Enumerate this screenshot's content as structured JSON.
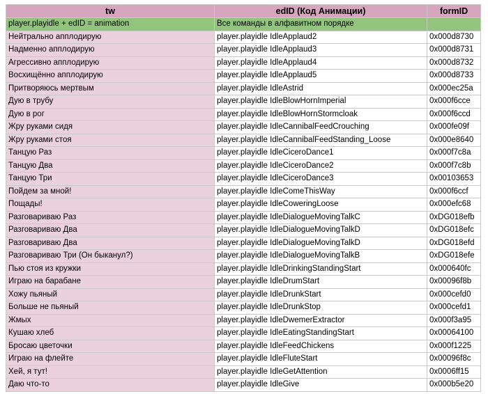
{
  "colors": {
    "header_bg": "#d5a6bd",
    "tw_column_bg": "#ead1dc",
    "subheader_bg": "#93c47d",
    "cell_bg": "#ffffff",
    "grid_line": "#c9c9c9"
  },
  "headers": {
    "tw": "tw",
    "edid": "edID (Код Анимации)",
    "formid": "formID"
  },
  "subheader": {
    "tw": "player.playidle + edID = animation",
    "edid": "Все команды в алфавитном порядке",
    "formid": ""
  },
  "rows": [
    {
      "tw": "Нейтрально апплодирую",
      "edid": "player.playidle IdleApplaud2",
      "formid": "0x000d8730"
    },
    {
      "tw": "Надменно апплодирую",
      "edid": "player.playidle IdleApplaud3",
      "formid": "0x000d8731"
    },
    {
      "tw": "Агрессивно апплодирую",
      "edid": "player.playidle IdleApplaud4",
      "formid": "0x000d8732"
    },
    {
      "tw": "Восхищённо апплодирую",
      "edid": "player.playidle IdleApplaud5",
      "formid": "0x000d8733"
    },
    {
      "tw": "Притворяюсь мертвым",
      "edid": "player.playidle IdleAstrid",
      "formid": "0x000ec25a"
    },
    {
      "tw": "Дую в трубу",
      "edid": "player.playidle IdleBlowHornImperial",
      "formid": "0x000f6cce"
    },
    {
      "tw": "Дую в рог",
      "edid": "player.playidle IdleBlowHornStormcloak",
      "formid": "0x000f6ccd"
    },
    {
      "tw": "Жру руками сидя",
      "edid": "player.playidle IdleCannibalFeedCrouching",
      "formid": "0x000fe09f"
    },
    {
      "tw": "Жру руками стоя",
      "edid": "player.playidle IdleCannibalFeedStanding_Loose",
      "formid": "0x000e8640"
    },
    {
      "tw": "Танцую Раз",
      "edid": "player.playidle IdleCiceroDance1",
      "formid": "0x000f7c8a"
    },
    {
      "tw": "Танцую Два",
      "edid": "player.playidle IdleCiceroDance2",
      "formid": "0x000f7c8b"
    },
    {
      "tw": "Танцую Три",
      "edid": "player.playidle IdleCiceroDance3",
      "formid": "0x00103653"
    },
    {
      "tw": "Пойдем за мной!",
      "edid": "player.playidle IdleComeThisWay",
      "formid": "0x000f6ccf"
    },
    {
      "tw": "Пощады!",
      "edid": "player.playidle IdleCoweringLoose",
      "formid": "0x000efc68"
    },
    {
      "tw": "Разговариваю Раз",
      "edid": "player.playidle IdleDialogueMovingTalkC",
      "formid": "0xDG018efb"
    },
    {
      "tw": "Разговариваю Два",
      "edid": "player.playidle IdleDialogueMovingTalkD",
      "formid": "0xDG018efc"
    },
    {
      "tw": "Разговариваю Два",
      "edid": "player.playidle IdleDialogueMovingTalkD",
      "formid": "0xDG018efd"
    },
    {
      "tw": "Разговариваю Три (Он быканул?)",
      "edid": "player.playidle IdleDialogueMovingTalkB",
      "formid": "0xDG018efe"
    },
    {
      "tw": "Пью стоя из кружки",
      "edid": "player.playidle IdleDrinkingStandingStart",
      "formid": "0x000640fc"
    },
    {
      "tw": "Играю на барабане",
      "edid": "player.playidle IdleDrumStart",
      "formid": "0x00096f8b"
    },
    {
      "tw": "Хожу пьяный",
      "edid": "player.playidle IdleDrunkStart",
      "formid": "0x000cefd0"
    },
    {
      "tw": "Больше не пьяный",
      "edid": "player.playidle IdleDrunkStop",
      "formid": "0x000cefd1"
    },
    {
      "tw": "Жмых",
      "edid": "player.playidle IdleDwemerExtractor",
      "formid": "0x000f3a95"
    },
    {
      "tw": "Кушаю хлеб",
      "edid": "player.playidle IdleEatingStandingStart",
      "formid": "0x00064100"
    },
    {
      "tw": "Бросаю цветочки",
      "edid": "player.playidle IdleFeedChickens",
      "formid": "0x000f1225"
    },
    {
      "tw": "Играю на флейте",
      "edid": "player.playidle IdleFluteStart",
      "formid": "0x00096f8c"
    },
    {
      "tw": "Хей, я тут!",
      "edid": "player.playidle IdleGetAttention",
      "formid": "0x0006ff15"
    },
    {
      "tw": "Даю что-то",
      "edid": "player.playidle IdleGive",
      "formid": "0x000b5e20"
    }
  ]
}
